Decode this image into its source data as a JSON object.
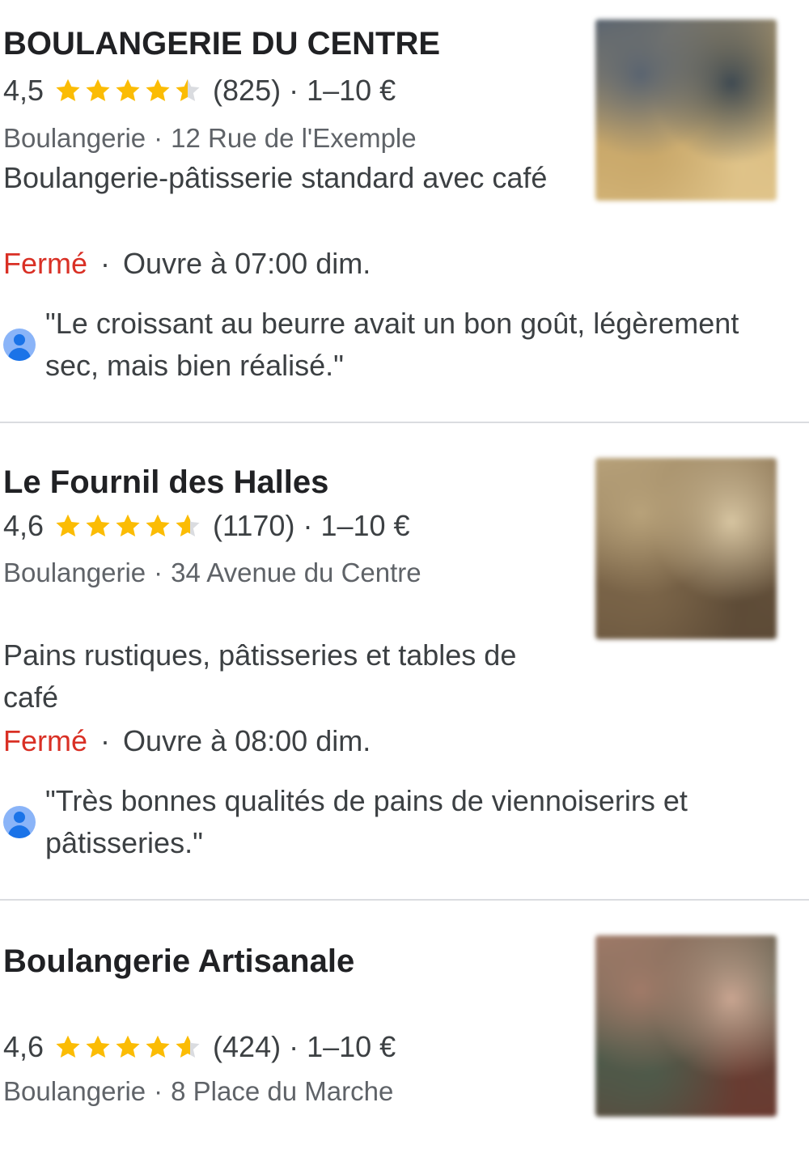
{
  "listings": [
    {
      "name": "BOULANGERIE DU CENTRE",
      "rating": "4,5",
      "rating_value": 4.5,
      "reviews": "(825)",
      "price": "1–10 €",
      "category": "Boulangerie",
      "address": "12 Rue de l'Exemple",
      "description": "Boulangerie-pâtisserie standard avec café",
      "status": "Fermé",
      "opens": "Ouvre à 07:00 dim.",
      "review": "\"Le croissant au beurre avait un bon goût, légèrement sec, mais bien réalisé.\"",
      "thumb_colors": [
        "#5a6470",
        "#c9a86a",
        "#3f4a52",
        "#e0c48a"
      ]
    },
    {
      "name": "Le Fournil des Halles",
      "rating": "4,6",
      "rating_value": 4.6,
      "reviews": "(1170)",
      "price": "1–10 €",
      "category": "Boulangerie",
      "address": "34 Avenue du Centre",
      "description": "Pains rustiques, pâtisseries et tables de café",
      "status": "Fermé",
      "opens": "Ouvre à 08:00 dim.",
      "review": "\"Très bonnes qualités de pains de viennoiserirs et pâtisseries.\"",
      "thumb_colors": [
        "#b8a27a",
        "#7a6448",
        "#d6c4a0",
        "#5c4a36"
      ]
    },
    {
      "name": "Boulangerie Artisanale",
      "rating": "4,6",
      "rating_value": 4.6,
      "reviews": "(424)",
      "price": "1–10 €",
      "category": "Boulangerie",
      "address": "8 Place du Marche",
      "thumb_colors": [
        "#a07a68",
        "#4e5a4a",
        "#c8a490",
        "#6a3a30"
      ]
    }
  ],
  "separator": "·",
  "colors": {
    "star": "#fbbc04",
    "star_empty": "#dadce0",
    "closed": "#d93025",
    "avatar": "#1a73e8"
  },
  "icons": {
    "star": "star-icon",
    "avatar": "user-avatar-icon"
  }
}
